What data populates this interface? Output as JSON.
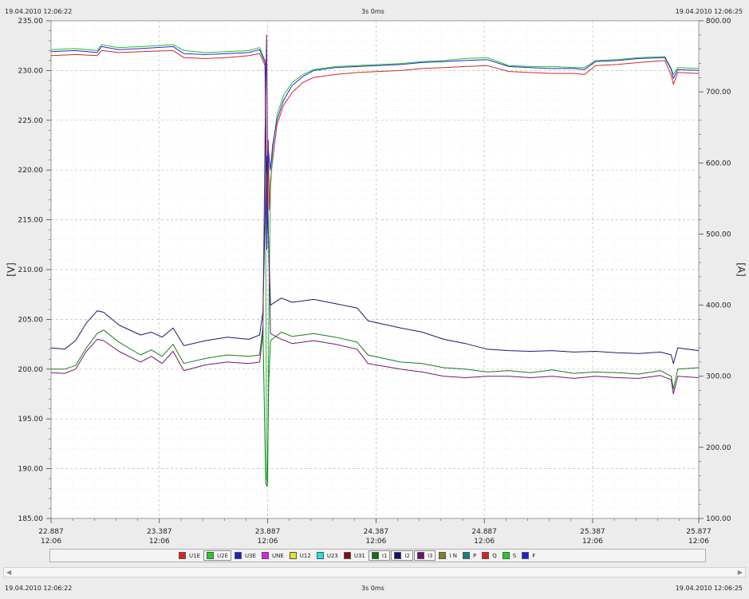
{
  "header": {
    "start_time": "19.04.2010 12:06:22",
    "duration": "3s 0ms",
    "end_time": "19.04.2010 12:06:25"
  },
  "footer": {
    "start_time": "19.04.2010 12:06:22",
    "duration": "3s 0ms",
    "end_time": "19.04.2010 12:06:25"
  },
  "legend": [
    {
      "label": "U1E",
      "color": "#e02020",
      "active": false
    },
    {
      "label": "U2E",
      "color": "#20d020",
      "active": true
    },
    {
      "label": "U3E",
      "color": "#2020d0",
      "active": false
    },
    {
      "label": "UNE",
      "color": "#e020e0",
      "active": false
    },
    {
      "label": "U12",
      "color": "#e8e020",
      "active": false
    },
    {
      "label": "U23",
      "color": "#20e0e0",
      "active": false
    },
    {
      "label": "U31",
      "color": "#801010",
      "active": false
    },
    {
      "label": "I1",
      "color": "#107010",
      "active": true
    },
    {
      "label": "I2",
      "color": "#101070",
      "active": true
    },
    {
      "label": "I3",
      "color": "#701070",
      "active": true
    },
    {
      "label": "I N",
      "color": "#808020",
      "active": false
    },
    {
      "label": "P",
      "color": "#108080",
      "active": false
    },
    {
      "label": "Q",
      "color": "#e02020",
      "active": false
    },
    {
      "label": "S",
      "color": "#20d020",
      "active": false
    },
    {
      "label": "F",
      "color": "#2020d0",
      "active": false
    }
  ],
  "chart_data": {
    "type": "line",
    "xlim": [
      22.887,
      25.877
    ],
    "x_ticks": [
      {
        "value": 22.887,
        "label": "22.887",
        "sub": "12:06"
      },
      {
        "value": 23.387,
        "label": "23.387",
        "sub": "12:06"
      },
      {
        "value": 23.887,
        "label": "23.887",
        "sub": "12:06"
      },
      {
        "value": 24.387,
        "label": "24.387",
        "sub": "12:06"
      },
      {
        "value": 24.887,
        "label": "24.887",
        "sub": "12:06"
      },
      {
        "value": 25.387,
        "label": "25.387",
        "sub": "12:06"
      },
      {
        "value": 25.877,
        "label": "25.877",
        "sub": "12:06"
      }
    ],
    "ylabel": "[V]",
    "ylim": [
      185,
      235
    ],
    "y_ticks": [
      "235.00",
      "230.00",
      "225.00",
      "220.00",
      "215.00",
      "210.00",
      "205.00",
      "200.00",
      "195.00",
      "190.00",
      "185.00"
    ],
    "y2label": "[A]",
    "y2lim": [
      100,
      800
    ],
    "y2_ticks": [
      "800.00",
      "700.00",
      "600.00",
      "500.00",
      "400.00",
      "300.00",
      "200.00",
      "100.00"
    ],
    "grid": true,
    "series": [
      {
        "name": "U1E",
        "axis": "left",
        "color": "#d02828",
        "points": [
          [
            22.887,
            231.5
          ],
          [
            23.0,
            231.6
          ],
          [
            23.1,
            231.5
          ],
          [
            23.12,
            232.0
          ],
          [
            23.2,
            231.8
          ],
          [
            23.3,
            231.9
          ],
          [
            23.45,
            232.0
          ],
          [
            23.5,
            231.3
          ],
          [
            23.6,
            231.2
          ],
          [
            23.7,
            231.3
          ],
          [
            23.8,
            231.5
          ],
          [
            23.85,
            231.7
          ],
          [
            23.875,
            230.5
          ],
          [
            23.885,
            214.0
          ],
          [
            23.89,
            223.0
          ],
          [
            23.895,
            216.0
          ],
          [
            23.9,
            219.0
          ],
          [
            23.91,
            221.0
          ],
          [
            23.93,
            224.5
          ],
          [
            23.96,
            226.5
          ],
          [
            24.0,
            227.8
          ],
          [
            24.05,
            228.8
          ],
          [
            24.1,
            229.3
          ],
          [
            24.2,
            229.6
          ],
          [
            24.3,
            229.8
          ],
          [
            24.4,
            229.9
          ],
          [
            24.5,
            230.0
          ],
          [
            24.6,
            230.2
          ],
          [
            24.7,
            230.3
          ],
          [
            24.8,
            230.4
          ],
          [
            24.9,
            230.5
          ],
          [
            25.0,
            229.9
          ],
          [
            25.1,
            229.8
          ],
          [
            25.2,
            229.7
          ],
          [
            25.3,
            229.7
          ],
          [
            25.35,
            229.6
          ],
          [
            25.4,
            230.5
          ],
          [
            25.5,
            230.6
          ],
          [
            25.6,
            230.8
          ],
          [
            25.72,
            231.0
          ],
          [
            25.75,
            229.5
          ],
          [
            25.76,
            228.6
          ],
          [
            25.78,
            229.8
          ],
          [
            25.877,
            229.7
          ]
        ]
      },
      {
        "name": "U2E",
        "axis": "left",
        "color": "#20c030",
        "points": [
          [
            22.887,
            232.1
          ],
          [
            23.0,
            232.2
          ],
          [
            23.1,
            232.0
          ],
          [
            23.12,
            232.6
          ],
          [
            23.2,
            232.3
          ],
          [
            23.3,
            232.4
          ],
          [
            23.45,
            232.6
          ],
          [
            23.5,
            232.0
          ],
          [
            23.6,
            231.8
          ],
          [
            23.7,
            231.9
          ],
          [
            23.8,
            232.0
          ],
          [
            23.85,
            232.3
          ],
          [
            23.875,
            231.0
          ],
          [
            23.882,
            189.0
          ],
          [
            23.887,
            188.5
          ],
          [
            23.892,
            205.0
          ],
          [
            23.9,
            218.0
          ],
          [
            23.91,
            222.0
          ],
          [
            23.93,
            225.5
          ],
          [
            23.96,
            227.5
          ],
          [
            24.0,
            228.8
          ],
          [
            24.05,
            229.6
          ],
          [
            24.1,
            230.1
          ],
          [
            24.2,
            230.4
          ],
          [
            24.3,
            230.5
          ],
          [
            24.4,
            230.6
          ],
          [
            24.5,
            230.7
          ],
          [
            24.6,
            230.9
          ],
          [
            24.7,
            231.0
          ],
          [
            24.8,
            231.2
          ],
          [
            24.9,
            231.3
          ],
          [
            25.0,
            230.5
          ],
          [
            25.1,
            230.4
          ],
          [
            25.2,
            230.4
          ],
          [
            25.3,
            230.3
          ],
          [
            25.35,
            230.3
          ],
          [
            25.4,
            231.0
          ],
          [
            25.5,
            231.1
          ],
          [
            25.6,
            231.3
          ],
          [
            25.72,
            231.4
          ],
          [
            25.75,
            230.2
          ],
          [
            25.76,
            229.6
          ],
          [
            25.78,
            230.3
          ],
          [
            25.877,
            230.2
          ]
        ]
      },
      {
        "name": "U3E",
        "axis": "left",
        "color": "#2828d0",
        "points": [
          [
            22.887,
            231.9
          ],
          [
            23.0,
            232.0
          ],
          [
            23.1,
            231.8
          ],
          [
            23.12,
            232.4
          ],
          [
            23.2,
            232.1
          ],
          [
            23.3,
            232.2
          ],
          [
            23.45,
            232.4
          ],
          [
            23.5,
            231.7
          ],
          [
            23.6,
            231.6
          ],
          [
            23.7,
            231.7
          ],
          [
            23.8,
            231.8
          ],
          [
            23.85,
            232.1
          ],
          [
            23.875,
            230.8
          ],
          [
            23.883,
            212.0
          ],
          [
            23.89,
            222.0
          ],
          [
            23.9,
            220.0
          ],
          [
            23.91,
            222.5
          ],
          [
            23.93,
            225.0
          ],
          [
            23.96,
            227.0
          ],
          [
            24.0,
            228.5
          ],
          [
            24.05,
            229.4
          ],
          [
            24.1,
            230.0
          ],
          [
            24.2,
            230.3
          ],
          [
            24.3,
            230.4
          ],
          [
            24.4,
            230.5
          ],
          [
            24.5,
            230.6
          ],
          [
            24.6,
            230.8
          ],
          [
            24.7,
            230.9
          ],
          [
            24.8,
            231.0
          ],
          [
            24.9,
            231.1
          ],
          [
            25.0,
            230.4
          ],
          [
            25.1,
            230.3
          ],
          [
            25.2,
            230.2
          ],
          [
            25.3,
            230.2
          ],
          [
            25.35,
            230.1
          ],
          [
            25.4,
            230.9
          ],
          [
            25.5,
            231.0
          ],
          [
            25.6,
            231.2
          ],
          [
            25.72,
            231.3
          ],
          [
            25.75,
            230.1
          ],
          [
            25.76,
            229.2
          ],
          [
            25.78,
            230.1
          ],
          [
            25.877,
            230.0
          ]
        ]
      },
      {
        "name": "I1",
        "axis": "right",
        "color": "#1a7a1a",
        "points": [
          [
            22.887,
            310
          ],
          [
            22.95,
            310
          ],
          [
            23.0,
            315
          ],
          [
            23.05,
            340
          ],
          [
            23.1,
            360
          ],
          [
            23.13,
            365
          ],
          [
            23.2,
            348
          ],
          [
            23.3,
            330
          ],
          [
            23.35,
            337
          ],
          [
            23.4,
            328
          ],
          [
            23.45,
            345
          ],
          [
            23.5,
            318
          ],
          [
            23.6,
            325
          ],
          [
            23.7,
            330
          ],
          [
            23.8,
            328
          ],
          [
            23.85,
            330
          ],
          [
            23.865,
            370
          ],
          [
            23.878,
            150
          ],
          [
            23.885,
            145
          ],
          [
            23.892,
            290
          ],
          [
            23.9,
            350
          ],
          [
            23.95,
            362
          ],
          [
            24.0,
            356
          ],
          [
            24.1,
            360
          ],
          [
            24.2,
            355
          ],
          [
            24.3,
            348
          ],
          [
            24.35,
            330
          ],
          [
            24.5,
            320
          ],
          [
            24.6,
            318
          ],
          [
            24.7,
            312
          ],
          [
            24.8,
            310
          ],
          [
            24.9,
            306
          ],
          [
            25.0,
            308
          ],
          [
            25.1,
            305
          ],
          [
            25.2,
            309
          ],
          [
            25.3,
            304
          ],
          [
            25.4,
            306
          ],
          [
            25.5,
            305
          ],
          [
            25.6,
            303
          ],
          [
            25.7,
            308
          ],
          [
            25.75,
            300
          ],
          [
            25.76,
            282
          ],
          [
            25.78,
            310
          ],
          [
            25.877,
            312
          ]
        ]
      },
      {
        "name": "I2",
        "axis": "right",
        "color": "#1a1a70",
        "points": [
          [
            22.887,
            340
          ],
          [
            22.95,
            338
          ],
          [
            23.0,
            350
          ],
          [
            23.05,
            375
          ],
          [
            23.1,
            392
          ],
          [
            23.13,
            390
          ],
          [
            23.2,
            372
          ],
          [
            23.3,
            358
          ],
          [
            23.35,
            362
          ],
          [
            23.4,
            355
          ],
          [
            23.45,
            368
          ],
          [
            23.5,
            343
          ],
          [
            23.6,
            350
          ],
          [
            23.7,
            355
          ],
          [
            23.8,
            352
          ],
          [
            23.85,
            358
          ],
          [
            23.865,
            390
          ],
          [
            23.878,
            560
          ],
          [
            23.885,
            610
          ],
          [
            23.89,
            500
          ],
          [
            23.9,
            400
          ],
          [
            23.95,
            410
          ],
          [
            24.0,
            404
          ],
          [
            24.1,
            408
          ],
          [
            24.2,
            402
          ],
          [
            24.3,
            396
          ],
          [
            24.35,
            378
          ],
          [
            24.5,
            368
          ],
          [
            24.6,
            362
          ],
          [
            24.7,
            352
          ],
          [
            24.8,
            346
          ],
          [
            24.9,
            338
          ],
          [
            25.0,
            336
          ],
          [
            25.1,
            335
          ],
          [
            25.2,
            336
          ],
          [
            25.3,
            334
          ],
          [
            25.4,
            335
          ],
          [
            25.5,
            333
          ],
          [
            25.6,
            332
          ],
          [
            25.7,
            334
          ],
          [
            25.75,
            330
          ],
          [
            25.76,
            318
          ],
          [
            25.78,
            340
          ],
          [
            25.877,
            336
          ]
        ]
      },
      {
        "name": "I3",
        "axis": "right",
        "color": "#701a70",
        "points": [
          [
            22.887,
            305
          ],
          [
            22.95,
            304
          ],
          [
            23.0,
            310
          ],
          [
            23.05,
            335
          ],
          [
            23.1,
            352
          ],
          [
            23.13,
            350
          ],
          [
            23.2,
            335
          ],
          [
            23.3,
            320
          ],
          [
            23.35,
            328
          ],
          [
            23.4,
            318
          ],
          [
            23.45,
            335
          ],
          [
            23.5,
            308
          ],
          [
            23.6,
            316
          ],
          [
            23.7,
            320
          ],
          [
            23.8,
            318
          ],
          [
            23.85,
            320
          ],
          [
            23.865,
            360
          ],
          [
            23.875,
            640
          ],
          [
            23.882,
            780
          ],
          [
            23.889,
            520
          ],
          [
            23.9,
            360
          ],
          [
            23.95,
            352
          ],
          [
            24.0,
            346
          ],
          [
            24.1,
            350
          ],
          [
            24.2,
            345
          ],
          [
            24.3,
            338
          ],
          [
            24.35,
            318
          ],
          [
            24.5,
            310
          ],
          [
            24.6,
            306
          ],
          [
            24.7,
            300
          ],
          [
            24.8,
            298
          ],
          [
            24.9,
            300
          ],
          [
            25.0,
            300
          ],
          [
            25.1,
            298
          ],
          [
            25.2,
            300
          ],
          [
            25.3,
            297
          ],
          [
            25.4,
            300
          ],
          [
            25.5,
            298
          ],
          [
            25.6,
            297
          ],
          [
            25.7,
            301
          ],
          [
            25.75,
            295
          ],
          [
            25.76,
            275
          ],
          [
            25.78,
            300
          ],
          [
            25.877,
            298
          ]
        ]
      }
    ]
  }
}
